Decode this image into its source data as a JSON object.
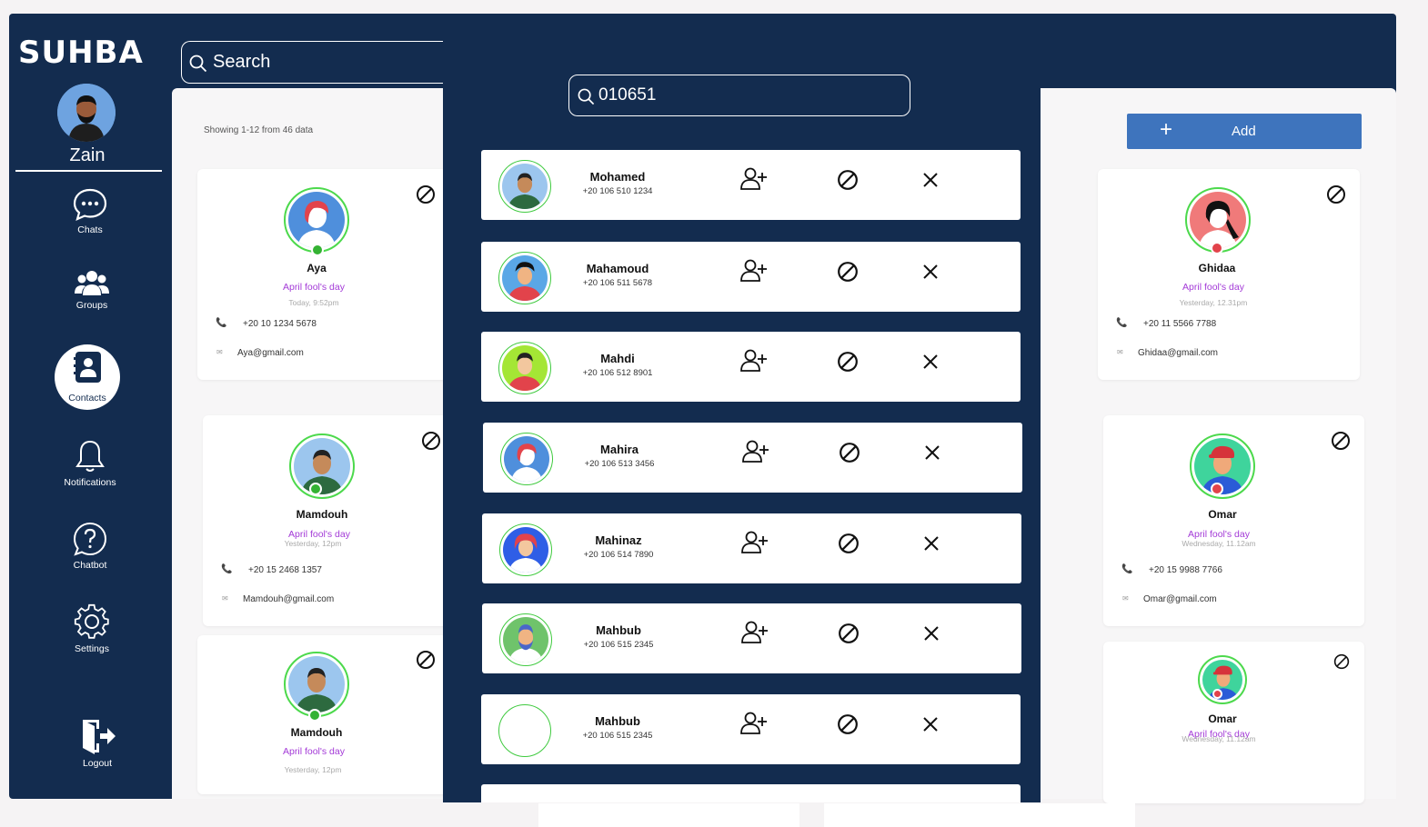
{
  "app": {
    "logo": "SUHBA",
    "user_name": "Zain"
  },
  "search": {
    "placeholder": "Search"
  },
  "nav": [
    {
      "label": "Chats",
      "icon": "chat-bubble-icon"
    },
    {
      "label": "Groups",
      "icon": "groups-icon"
    },
    {
      "label": "Contacts",
      "icon": "contacts-icon",
      "active": true
    },
    {
      "label": "Notifications",
      "icon": "bell-icon"
    },
    {
      "label": "Chatbot",
      "icon": "help-circle-icon"
    },
    {
      "label": "Settings",
      "icon": "gear-icon"
    },
    {
      "label": "Logout",
      "icon": "logout-icon"
    }
  ],
  "list": {
    "showing": "Showing 1-12 from 46 data",
    "add_label": "Add"
  },
  "contacts": [
    {
      "name": "Aya",
      "status": "April fool's day",
      "time": "Today, 9:52pm",
      "phone": "+20 10 1234 5678",
      "email": "Aya@gmail.com",
      "presence": "online"
    },
    {
      "name": "Ghidaa",
      "status": "April fool's day",
      "time": "Yesterday, 12.31pm",
      "phone": "+20 11 5566 7788",
      "email": "Ghidaa@gmail.com",
      "presence": "busy"
    },
    {
      "name": "Mamdouh",
      "status": "April fool's day",
      "time": "Yesterday, 12pm",
      "phone": "+20 15 2468 1357",
      "email": "Mamdouh@gmail.com",
      "presence": "online"
    },
    {
      "name": "Omar",
      "status": "April fool's day",
      "time": "Wednesday, 11.12am",
      "phone": "+20 15 9988 7766",
      "email": "Omar@gmail.com",
      "presence": "busy"
    },
    {
      "name": "Mamdouh",
      "status": "April fool's day",
      "time": "Yesterday, 12pm",
      "presence": "online"
    },
    {
      "name": "Omar",
      "status": "April fool's day",
      "time": "Wednesday, 11.12am",
      "presence": "busy"
    }
  ],
  "overlay": {
    "search_value": "010651",
    "results": [
      {
        "name": "Mohamed",
        "phone": "+20 106 510 1234"
      },
      {
        "name": "Mahamoud",
        "phone": "+20 106 511 5678"
      },
      {
        "name": "Mahdi",
        "phone": "+20 106 512 8901"
      },
      {
        "name": "Mahira",
        "phone": "+20 106 513 3456"
      },
      {
        "name": "Mahinaz",
        "phone": "+20 106 514 7890"
      },
      {
        "name": "Mahbub",
        "phone": "+20 106 515 2345"
      },
      {
        "name": "Mahbub",
        "phone": "+20 106 515 2345"
      }
    ]
  },
  "colors": {
    "navy": "#132c4f",
    "accent": "#3e74bd",
    "status_purple": "#a33ad7",
    "online": "#34b233",
    "busy": "#e2434b"
  }
}
